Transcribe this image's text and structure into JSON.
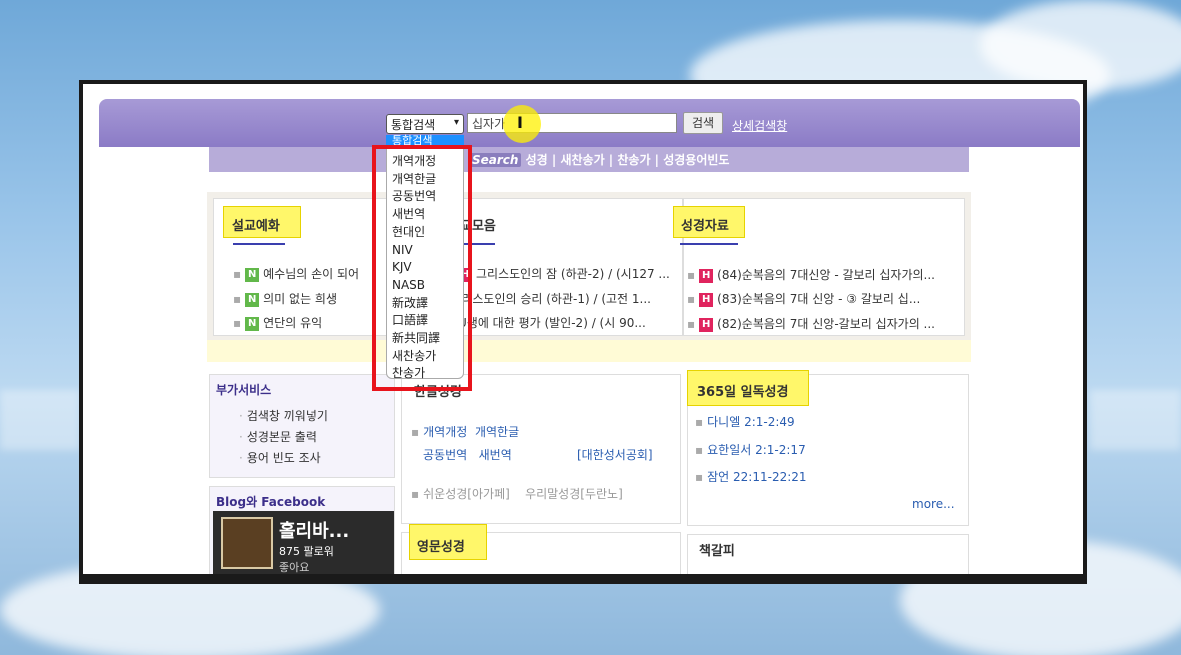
{
  "search": {
    "select_value": "통합검색",
    "select_arrow": "▾",
    "input_value": "십자가",
    "button_label": "검색",
    "advanced_link": "상세검색창",
    "dropdown_highlight": "통합검색",
    "dropdown_options": [
      "개역개정",
      "개역한글",
      "공동번역",
      "새번역",
      "현대인",
      "NIV",
      "KJV",
      "NASB",
      "新改譯",
      "口語譯",
      "新共同譯",
      "새찬송가",
      "찬송가"
    ]
  },
  "subnav": {
    "search_tag": "Search",
    "items": "성경 | 새찬송가 | 찬송가 | 성경용어빈도"
  },
  "sermon_panel": {
    "title": "설교예화",
    "rows": [
      {
        "badge": "N",
        "text": "예수님의 손이 되어"
      },
      {
        "badge": "N",
        "text": "의미 없는 희생"
      },
      {
        "badge": "N",
        "text": "연단의 유익"
      }
    ]
  },
  "middle_panel": {
    "title_partial": "교모음",
    "rows": [
      {
        "badge": "H",
        "text": "그리스도인의 잠 (하관-2) / (시127 ..."
      },
      {
        "text": "l리스도인의 승리 (하관-1) / (고전 1..."
      },
      {
        "text": "U생에 대한 평가 (발인-2) / (시 90..."
      }
    ]
  },
  "bible_panel": {
    "title": "성경자료",
    "rows": [
      {
        "badge": "H",
        "text": "(84)순복음의 7대신앙 - 갈보리 십자가의..."
      },
      {
        "badge": "H",
        "text": "(83)순복음의 7대 신앙 - ③ 갈보리 십..."
      },
      {
        "badge": "H",
        "text": "(82)순복음의 7대 신앙-갈보리 십자가의 ..."
      }
    ]
  },
  "extra_services": {
    "title": "부가서비스",
    "links": [
      "검색창 끼워넣기",
      "성경본문 출력",
      "용어 빈도 조사"
    ]
  },
  "blog": {
    "title": "Blog와 Facebook",
    "page_name": "홀리바...",
    "followers": "875 팔로워",
    "sub": "좋아요"
  },
  "korean_bible": {
    "title": "한글성경",
    "line1": [
      "개역개정",
      "개역한글"
    ],
    "line2": [
      "공동번역",
      "새번역"
    ],
    "publisher": "[대한성서공회]",
    "line3": [
      "쉬운성경[아가페]",
      "우리말성경[두란노]"
    ]
  },
  "daily_reading": {
    "title": "365일 일독성경",
    "items": [
      "다니엘 2:1-2:49",
      "요한일서 2:1-2:17",
      "잠언 22:11-22:21"
    ],
    "more": "more..."
  },
  "english_bible": {
    "title": "영문성경"
  },
  "bookmark": {
    "title": "책갈피"
  },
  "colors": {
    "header_purple": "#8b7bc6",
    "subnav_lavender": "#b7acd9",
    "highlight_yellow": "#fff76a",
    "annotation_red": "#e8141c",
    "badge_new": "#62b84a",
    "badge_hot": "#e0245e"
  }
}
